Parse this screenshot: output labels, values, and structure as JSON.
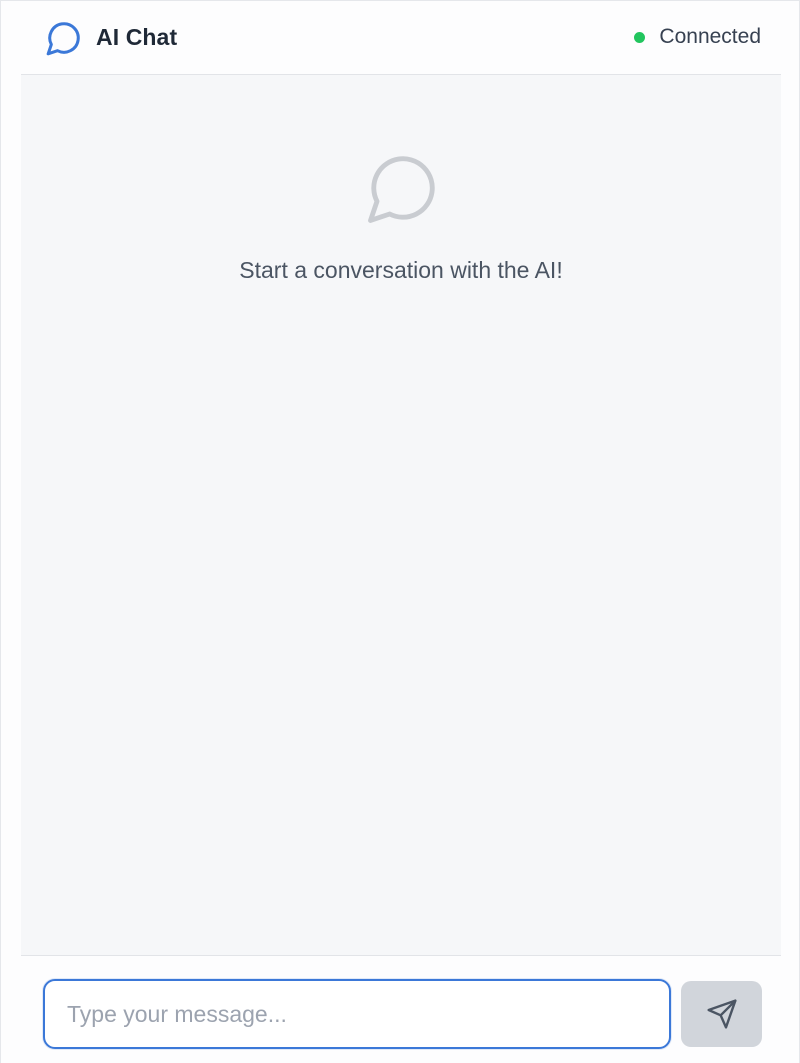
{
  "header": {
    "title": "AI Chat",
    "logo_icon": "chat-bubble-icon",
    "status": {
      "text": "Connected",
      "dot_color": "#22c55e"
    }
  },
  "messages": {
    "empty_icon": "chat-bubble-icon",
    "empty_text": "Start a conversation with the AI!"
  },
  "composer": {
    "placeholder": "Type your message...",
    "value": "",
    "send_icon": "send-icon",
    "send_disabled": true
  },
  "colors": {
    "accent": "#3b78d8",
    "text_primary": "#1f2937",
    "muted": "#9ca3af",
    "background": "#f6f7f9",
    "button_disabled": "#d1d5db"
  }
}
